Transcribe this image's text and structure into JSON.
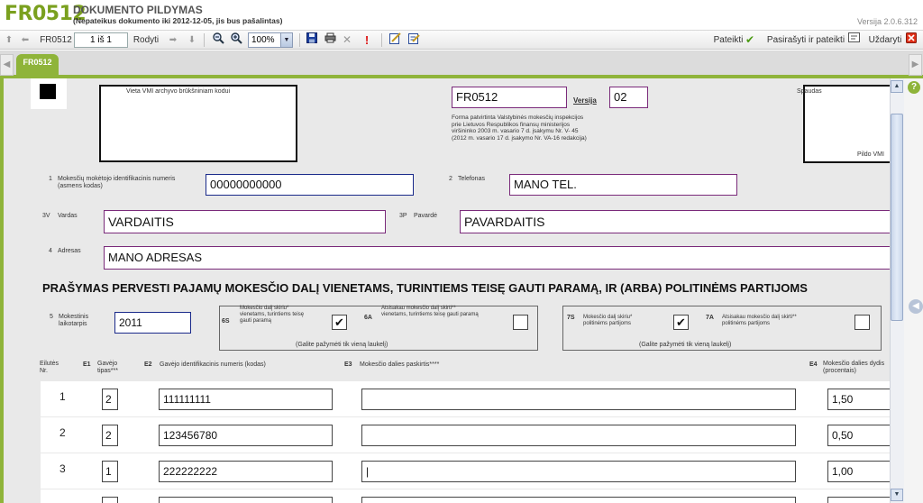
{
  "header": {
    "logo": "FR0512",
    "title": "DOKUMENTO PILDYMAS",
    "subtitle": "(Nepateikus dokumento iki 2012-12-05, jis bus pašalintas)",
    "version": "Versija 2.0.6.312"
  },
  "toolbar": {
    "form_code": "FR0512",
    "page_value": "1 iš 1",
    "show_label": "Rodyti",
    "zoom": "100%",
    "submit_label": "Pateikti",
    "sign_submit_label": "Pasirašyti ir pateikti",
    "close_label": "Uždaryti"
  },
  "tab": {
    "label": "FR0512"
  },
  "form": {
    "vmi_place_label": "Vieta VMI archyvo brūkšniniam kodui",
    "form_code": "FR0512",
    "versija_label": "Versija",
    "versija_value": "02",
    "approval_text": [
      "Forma patvirtinta Valstybinės mokesčių inspekcijos",
      "prie Lietuvos Respublikos finansų ministerijos",
      "viršininko 2003 m. vasario 7 d. įsakymu Nr. V- 45",
      "(2012 m. vasario 17 d. įsakymo Nr. VA-16 redakcija)"
    ],
    "stamp_label": "Spaudas",
    "fills_vmi": "Pildo VMI",
    "f1_num": "1",
    "f1_label": [
      "Mokesčių mokėtojo identifikacinis numeris",
      "(asmens kodas)"
    ],
    "f1_value": "00000000000",
    "f2_num": "2",
    "f2_label": "Telefonas",
    "f2_value": "MANO TEL.",
    "f3v_num": "3V",
    "f3v_label": "Vardas",
    "f3v_value": "VARDAITIS",
    "f3p_num": "3P",
    "f3p_label": "Pavardė",
    "f3p_value": "PAVARDAITIS",
    "f4_num": "4",
    "f4_label": "Adresas",
    "f4_value": "MANO ADRESAS",
    "heading": "PRAŠYMAS PERVESTI PAJAMŲ MOKESČIO DALĮ VIENETAMS, TURINTIEMS TEISĘ GAUTI PARAMĄ, IR (ARBA) POLITINĖMS PARTIJOMS",
    "f5_num": "5",
    "f5_label": [
      "Mokestinis",
      "laikotarpis"
    ],
    "f5_value": "2011",
    "g6s_num": "6S",
    "g6s_label": [
      "Mokesčio dalį skiriu*",
      "vienetams, turintiems teisę",
      "gauti paramą"
    ],
    "g6s_checked": "✔",
    "g6a_num": "6A",
    "g6a_label": [
      "Atsisakau mokesčio dalį skirti**",
      "vienetams, turintiems teisę gauti paramą"
    ],
    "g6a_checked": "",
    "g6_note": "(Galite pažymėti tik vieną laukelį)",
    "g7s_num": "7S",
    "g7s_label": [
      "Mokesčio dalį skiriu*",
      "politinėms partijoms"
    ],
    "g7s_checked": "✔",
    "g7a_num": "7A",
    "g7a_label": [
      "Atsisakau mokesčio dalį skirti**",
      "politinėms partijoms"
    ],
    "g7a_checked": "",
    "g7_note": "(Galite pažymėti tik vieną laukelį)",
    "cols": {
      "nr": [
        "Eilutės",
        "Nr."
      ],
      "e1": "E1",
      "e1_label": [
        "Gavėjo",
        "tipas***"
      ],
      "e2": "E2",
      "e2_label": "Gavėjo identifikacinis numeris (kodas)",
      "e3": "E3",
      "e3_label": "Mokesčio dalies paskirtis****",
      "e4": "E4",
      "e4_label": [
        "Mokesčio dalies dydis",
        "(procentais)"
      ]
    },
    "rows": [
      {
        "nr": "1",
        "type": "2",
        "code": "111111111",
        "purpose": "",
        "percent": "1,50"
      },
      {
        "nr": "2",
        "type": "2",
        "code": "123456780",
        "purpose": "",
        "percent": "0,50"
      },
      {
        "nr": "3",
        "type": "1",
        "code": "222222222",
        "purpose": "|",
        "percent": "1,00"
      }
    ]
  }
}
